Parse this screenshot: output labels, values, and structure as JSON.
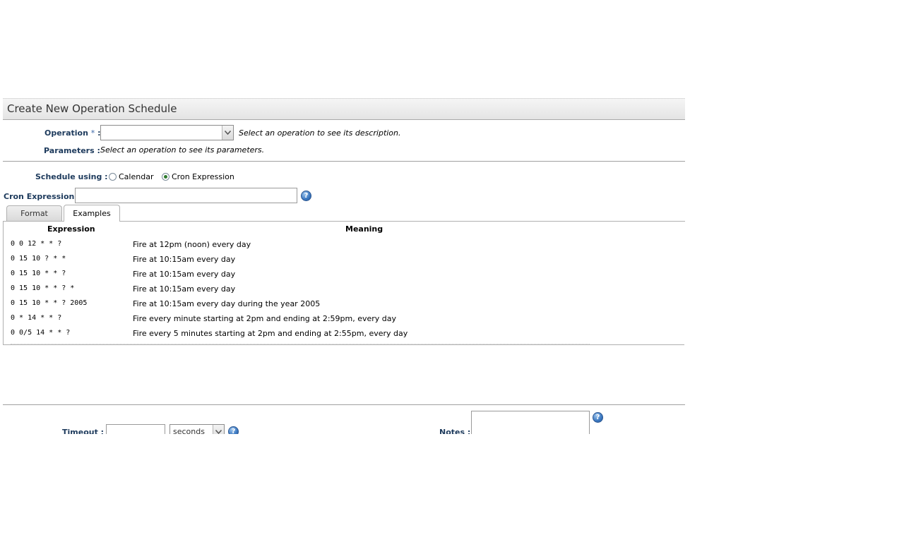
{
  "header": {
    "title": "Create New Operation Schedule"
  },
  "operation": {
    "label": "Operation",
    "required_mark": "*",
    "colon": " :",
    "value": "",
    "hint": "Select an operation to see its description."
  },
  "parameters": {
    "label": "Parameters :",
    "hint": "Select an operation to see its parameters."
  },
  "schedule": {
    "label": "Schedule using :",
    "options": [
      {
        "label": "Calendar",
        "selected": false
      },
      {
        "label": "Cron Expression",
        "selected": true
      }
    ]
  },
  "cron": {
    "label": "Cron Expression :",
    "value": "",
    "help_icon": "help-icon"
  },
  "tabs": [
    {
      "label": "Format",
      "active": false
    },
    {
      "label": "Examples",
      "active": true
    }
  ],
  "examples": {
    "headers": {
      "expression": "Expression",
      "meaning": "Meaning"
    },
    "rows": [
      {
        "expression": "0 0 12 * * ?",
        "meaning": "Fire at 12pm (noon) every day"
      },
      {
        "expression": "0 15 10 ? * *",
        "meaning": "Fire at 10:15am every day"
      },
      {
        "expression": "0 15 10 * * ?",
        "meaning": "Fire at 10:15am every day"
      },
      {
        "expression": "0 15 10 * * ? *",
        "meaning": "Fire at 10:15am every day"
      },
      {
        "expression": "0 15 10 * * ? 2005",
        "meaning": "Fire at 10:15am every day during the year 2005"
      },
      {
        "expression": "0 * 14 * * ?",
        "meaning": "Fire every minute starting at 2pm and ending at 2:59pm, every day"
      },
      {
        "expression": "0 0/5 14 * * ?",
        "meaning": "Fire every 5 minutes starting at 2pm and ending at 2:55pm, every day"
      }
    ]
  },
  "timeout": {
    "label": "Timeout :",
    "value": "",
    "unit": "seconds"
  },
  "notes": {
    "label": "Notes :",
    "value": ""
  }
}
